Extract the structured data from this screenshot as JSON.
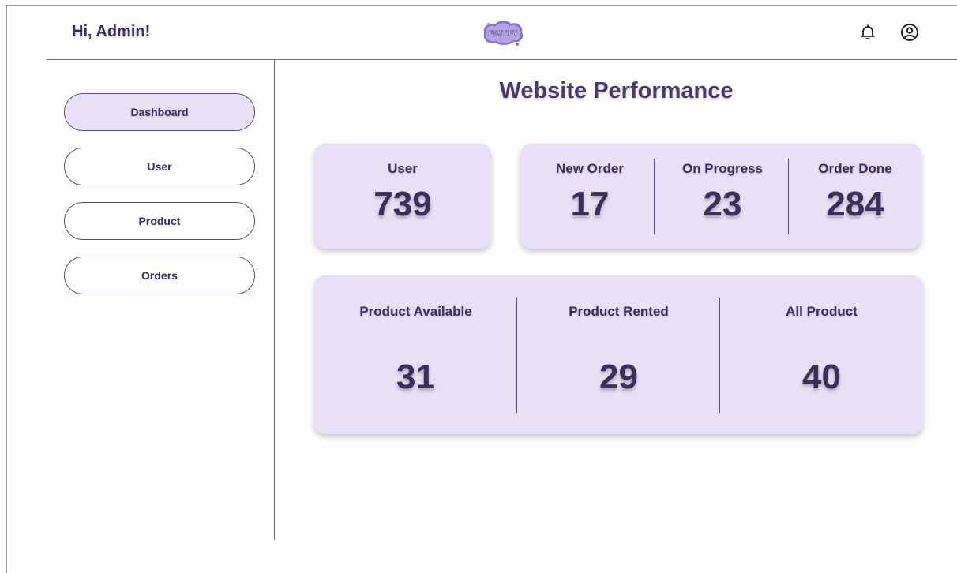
{
  "header": {
    "greeting": "Hi, Admin!",
    "logo_text": "FESTIFY",
    "brand_color": "#3d2f5b",
    "accent_color": "#e8e0f7",
    "icons": [
      "bell-icon",
      "account-circle-icon"
    ]
  },
  "sidebar": {
    "items": [
      {
        "label": "Dashboard",
        "active": true
      },
      {
        "label": "User",
        "active": false
      },
      {
        "label": "Product",
        "active": false
      },
      {
        "label": "Orders",
        "active": false
      }
    ]
  },
  "main": {
    "title": "Website Performance",
    "user_card": {
      "label": "User",
      "value": "739"
    },
    "order_card": [
      {
        "label": "New Order",
        "value": "17"
      },
      {
        "label": "On Progress",
        "value": "23"
      },
      {
        "label": "Order Done",
        "value": "284"
      }
    ],
    "product_card": [
      {
        "label": "Product Available",
        "value": "31"
      },
      {
        "label": "Product Rented",
        "value": "29"
      },
      {
        "label": "All Product",
        "value": "40"
      }
    ]
  }
}
